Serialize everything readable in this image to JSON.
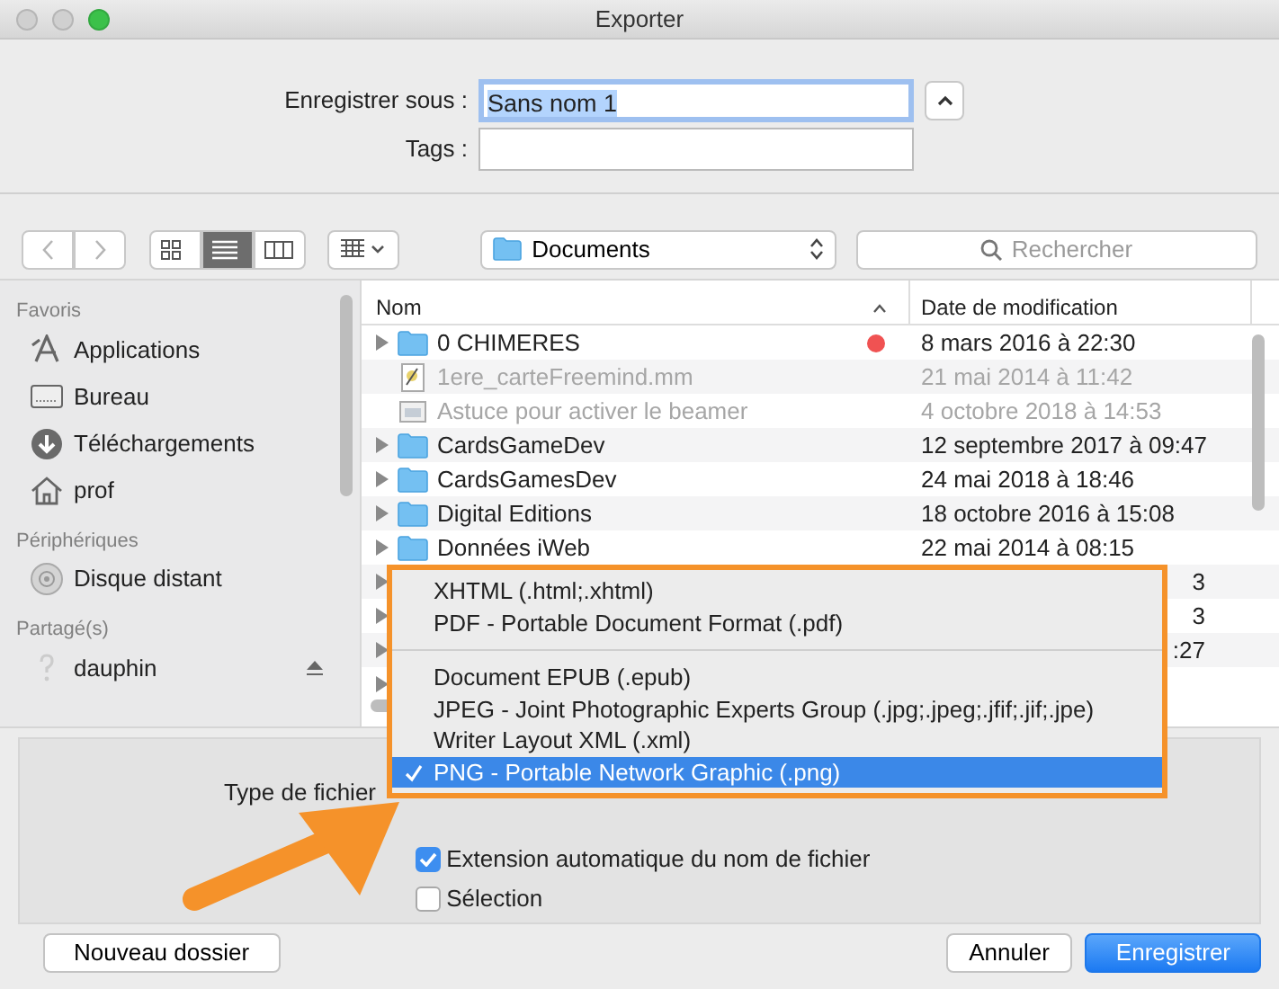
{
  "window": {
    "title": "Exporter"
  },
  "form": {
    "save_as_label": "Enregistrer sous :",
    "save_as_value": "Sans nom 1",
    "tags_label": "Tags :"
  },
  "toolbar": {
    "views": [
      {
        "kind": "icons",
        "selected": false
      },
      {
        "kind": "list",
        "selected": true
      },
      {
        "kind": "columns",
        "selected": false
      }
    ],
    "location": "Documents",
    "search": {
      "placeholder": "Rechercher"
    }
  },
  "sidebar": {
    "sections": [
      {
        "title": "Favoris",
        "items": [
          {
            "label": "Applications",
            "kind": "apps"
          },
          {
            "label": "Bureau",
            "kind": "desktop"
          },
          {
            "label": "Téléchargements",
            "kind": "download"
          },
          {
            "label": "prof",
            "kind": "home"
          }
        ]
      },
      {
        "title": "Périphériques",
        "items": [
          {
            "label": "Disque distant",
            "kind": "disc"
          }
        ]
      },
      {
        "title": "Partagé(s)",
        "items": [
          {
            "label": "dauphin",
            "kind": "server"
          }
        ]
      }
    ]
  },
  "table": {
    "columns": [
      "Nom",
      "Date de modification"
    ],
    "rows": [
      {
        "kind": "folder",
        "name": "0 CHIMERES",
        "date": "8 mars 2016 à 22:30",
        "disabled": false,
        "color": "#f05252"
      },
      {
        "kind": "document",
        "name": "1ere_carteFreemind.mm",
        "date": "21 mai 2014 à 11:42",
        "disabled": true
      },
      {
        "kind": "image",
        "name": "Astuce pour activer le beamer",
        "date": "4 octobre 2018 à 14:53",
        "disabled": true
      },
      {
        "kind": "folder",
        "name": "CardsGameDev",
        "date": "12 septembre 2017 à 09:47",
        "disabled": false
      },
      {
        "kind": "folder",
        "name": "CardsGamesDev",
        "date": "24 mai 2018 à 18:46",
        "disabled": false
      },
      {
        "kind": "folder",
        "name": "Digital Editions",
        "date": "18 octobre 2016 à 15:08",
        "disabled": false
      },
      {
        "kind": "folder",
        "name": "Données iWeb",
        "date": "22 mai 2014 à 08:15",
        "disabled": false
      },
      {
        "kind": "folder",
        "date": "3"
      },
      {
        "kind": "folder",
        "date": "3"
      },
      {
        "kind": "folder",
        "date": ":27"
      },
      {
        "kind": "folder"
      }
    ]
  },
  "options": {
    "file_type_label": "Type de fichier",
    "checkboxes": [
      {
        "label": "Extension automatique du nom de fichier",
        "checked": true
      },
      {
        "label": "Sélection",
        "checked": false
      }
    ]
  },
  "file_type_menu": {
    "groups": [
      [
        {
          "label": "XHTML (.html;.xhtml)",
          "selected": false
        },
        {
          "label": "PDF - Portable Document Format (.pdf)",
          "selected": false
        }
      ],
      [
        {
          "label": "Document EPUB (.epub)",
          "selected": false
        },
        {
          "label": "JPEG - Joint Photographic Experts Group (.jpg;.jpeg;.jfif;.jif;.jpe)",
          "selected": false
        },
        {
          "label": "Writer Layout XML (.xml)",
          "selected": false
        },
        {
          "label": "PNG - Portable Network Graphic (.png)",
          "selected": true
        }
      ]
    ]
  },
  "buttons": [
    {
      "label": "Nouveau dossier",
      "kind": "secondary"
    },
    {
      "label": "Annuler",
      "kind": "secondary"
    },
    {
      "label": "Enregistrer",
      "kind": "primary"
    }
  ]
}
